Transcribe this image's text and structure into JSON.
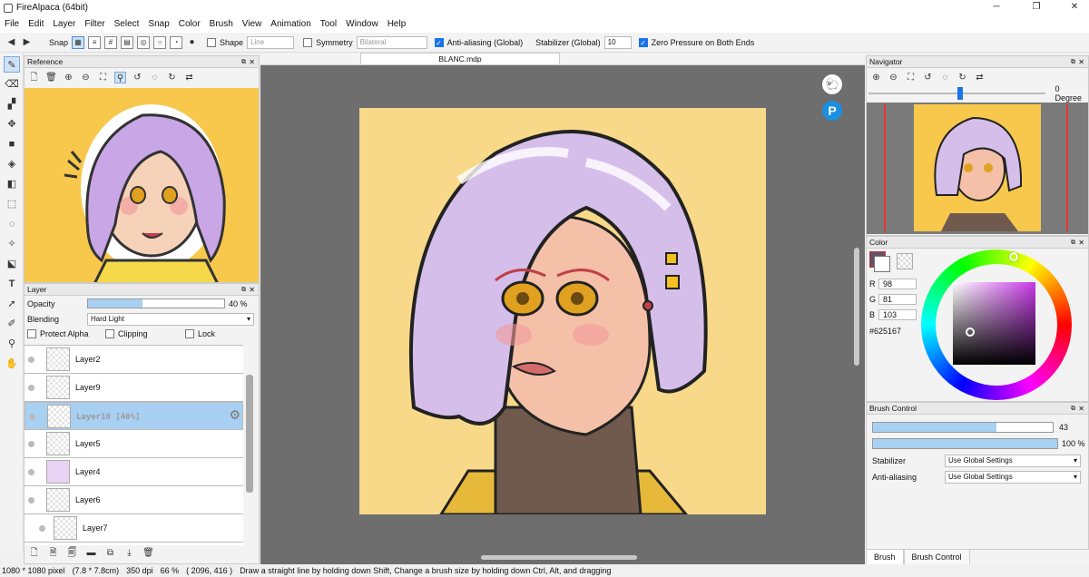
{
  "window": {
    "title": "FireAlpaca (64bit)"
  },
  "menu": [
    "File",
    "Edit",
    "Layer",
    "Filter",
    "Select",
    "Snap",
    "Color",
    "Brush",
    "View",
    "Animation",
    "Tool",
    "Window",
    "Help"
  ],
  "toolbar": {
    "snap_label": "Snap",
    "shape_label": "Shape",
    "shape_value": "Line",
    "symmetry_label": "Symmetry",
    "symmetry_value": "Bilateral",
    "antialias_label": "Anti-aliasing (Global)",
    "stabilizer_label": "Stabilizer (Global)",
    "stabilizer_value": "10",
    "zero_pressure_label": "Zero Pressure on Both Ends"
  },
  "reference_panel": {
    "title": "Reference"
  },
  "layer_panel": {
    "title": "Layer",
    "opacity_label": "Opacity",
    "opacity_value": "40 %",
    "opacity_fraction": 0.4,
    "blending_label": "Blending",
    "blending_value": "Hard Light",
    "protect_alpha_label": "Protect Alpha",
    "clipping_label": "Clipping",
    "lock_label": "Lock",
    "layers": [
      {
        "name": "Layer2"
      },
      {
        "name": "Layer9"
      },
      {
        "name": "Layer10 [40%]",
        "selected": true
      },
      {
        "name": "Layer5"
      },
      {
        "name": "Layer4"
      },
      {
        "name": "Layer6"
      },
      {
        "name": "Layer7"
      }
    ]
  },
  "canvas": {
    "tab_title": "BLANC.mdp"
  },
  "navigator": {
    "title": "Navigator",
    "rotation_value": "0 Degree"
  },
  "color_panel": {
    "title": "Color",
    "r_label": "R",
    "r_value": "98",
    "g_label": "G",
    "g_value": "81",
    "b_label": "B",
    "b_value": "103",
    "hex": "#625167",
    "current_color": "#625167"
  },
  "brush_control": {
    "title": "Brush Control",
    "size_value": "43",
    "opacity_value": "100 %",
    "stabilizer_label": "Stabilizer",
    "stabilizer_value": "Use Global Settings",
    "antialias_label": "Anti-aliasing",
    "antialias_value": "Use Global Settings"
  },
  "bottom_tabs": {
    "brush": "Brush",
    "brush_control": "Brush Control"
  },
  "status": {
    "size": "1080 * 1080 pixel",
    "cm": "(7.8 * 7.8cm)",
    "dpi": "350 dpi",
    "zoom": "66 %",
    "coords": "( 2096, 416 )",
    "hint": "Draw a straight line by holding down Shift, Change a brush size by holding down Ctrl, Alt, and dragging"
  }
}
